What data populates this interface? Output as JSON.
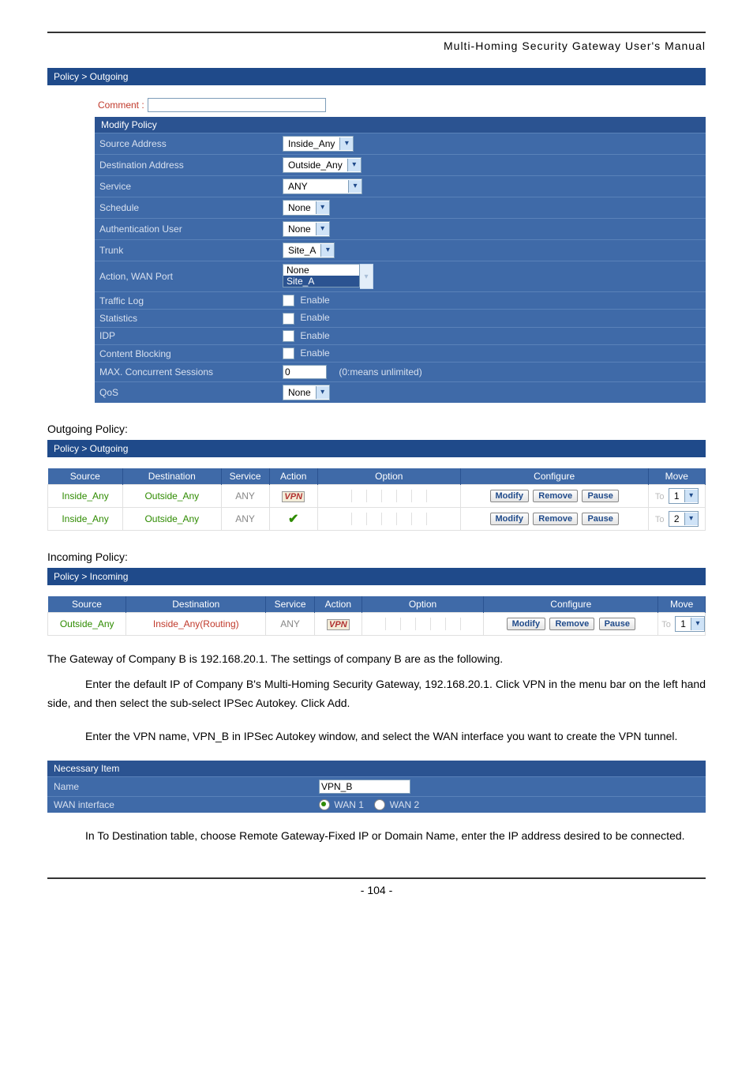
{
  "doc": {
    "title": "Multi-Homing  Security  Gateway  User's  Manual",
    "page_number": "- 104 -"
  },
  "modify": {
    "breadcrumb": "Policy > Outgoing",
    "comment_label": "Comment :",
    "comment_value": "",
    "header": "Modify Policy",
    "rows": {
      "source_addr": {
        "label": "Source Address",
        "value": "Inside_Any"
      },
      "dest_addr": {
        "label": "Destination Address",
        "value": "Outside_Any"
      },
      "service": {
        "label": "Service",
        "value": "ANY"
      },
      "schedule": {
        "label": "Schedule",
        "value": "None"
      },
      "auth_user": {
        "label": "Authentication User",
        "value": "None"
      },
      "trunk": {
        "label": "Trunk",
        "value": "Site_A"
      },
      "action_wan": {
        "label": "Action, WAN Port",
        "opt1": "None",
        "opt2": "Site_A"
      },
      "traffic_log": {
        "label": "Traffic Log",
        "value": "Enable"
      },
      "statistics": {
        "label": "Statistics",
        "value": "Enable"
      },
      "idp": {
        "label": "IDP",
        "value": "Enable"
      },
      "content_blk": {
        "label": "Content Blocking",
        "value": "Enable"
      },
      "max_sess": {
        "label": "MAX. Concurrent Sessions",
        "value": "0",
        "hint": "(0:means unlimited)"
      },
      "qos": {
        "label": "QoS",
        "value": "None"
      }
    }
  },
  "outgoing": {
    "section_label": "Outgoing Policy:",
    "breadcrumb": "Policy > Outgoing",
    "headers": {
      "source": "Source",
      "dest": "Destination",
      "service": "Service",
      "action": "Action",
      "option": "Option",
      "configure": "Configure",
      "move": "Move"
    },
    "rows": [
      {
        "source": "Inside_Any",
        "dest": "Outside_Any",
        "service": "ANY",
        "action": "VPN",
        "modify": "Modify",
        "remove": "Remove",
        "pause": "Pause",
        "moveTo": "To",
        "moveVal": "1"
      },
      {
        "source": "Inside_Any",
        "dest": "Outside_Any",
        "service": "ANY",
        "action": "CHECK",
        "modify": "Modify",
        "remove": "Remove",
        "pause": "Pause",
        "moveTo": "To",
        "moveVal": "2"
      }
    ]
  },
  "incoming": {
    "section_label": "Incoming Policy:",
    "breadcrumb": "Policy > Incoming",
    "headers": {
      "source": "Source",
      "dest": "Destination",
      "service": "Service",
      "action": "Action",
      "option": "Option",
      "configure": "Configure",
      "move": "Move"
    },
    "rows": [
      {
        "source": "Outside_Any",
        "dest": "Inside_Any(Routing)",
        "service": "ANY",
        "action": "VPN",
        "modify": "Modify",
        "remove": "Remove",
        "pause": "Pause",
        "moveTo": "To",
        "moveVal": "1"
      }
    ]
  },
  "text": {
    "p1": "The Gateway of Company B is 192.168.20.1. The settings of company B are as the following.",
    "p2": "Enter the default IP of Company B's Multi-Homing Security Gateway, 192.168.20.1. Click VPN in the menu bar on the left hand side, and then select the sub-select IPSec Autokey. Click Add.",
    "p3": "Enter the VPN name, VPN_B in IPSec Autokey window, and select the WAN interface you want to create the VPN tunnel.",
    "p4": "In To Destination table, choose Remote Gateway-Fixed IP or Domain Name, enter the IP address desired to be connected."
  },
  "necessary": {
    "header": "Necessary Item",
    "name_label": "Name",
    "name_value": "VPN_B",
    "wan_label": "WAN interface",
    "wan1": "WAN 1",
    "wan2": "WAN 2"
  }
}
